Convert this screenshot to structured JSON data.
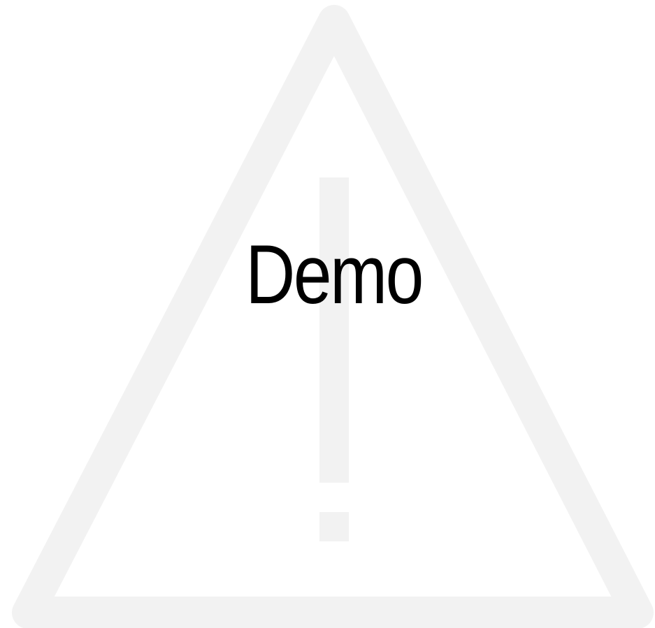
{
  "watermark": {
    "icon": "warning-triangle-icon",
    "color": "#f2f2f2"
  },
  "label": {
    "text": "Demo",
    "color": "#000000"
  }
}
